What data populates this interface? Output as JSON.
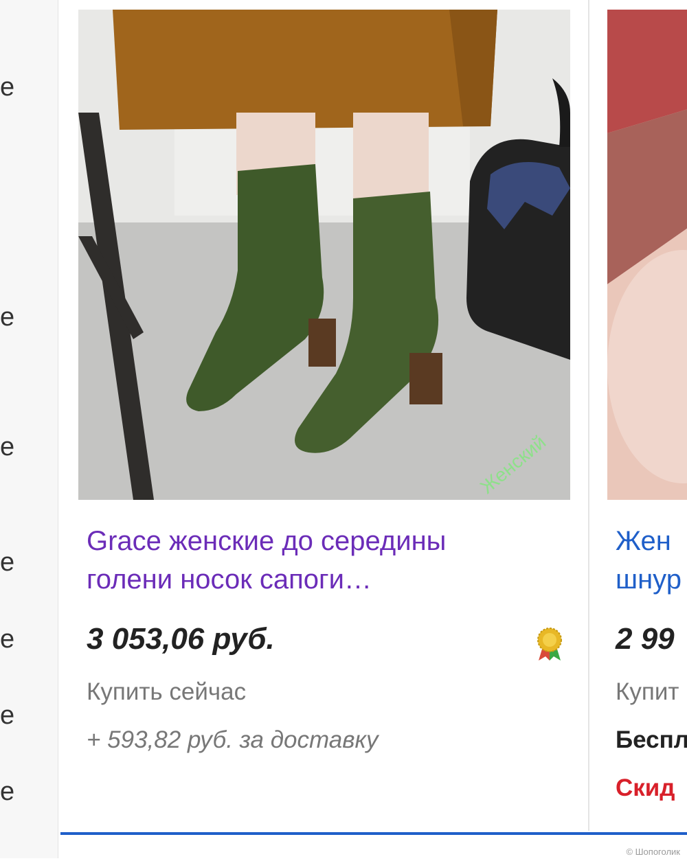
{
  "sidebar": {
    "fragments": [
      "e",
      "e",
      "e",
      "e",
      "e",
      "e",
      "e"
    ]
  },
  "product1": {
    "title_line1": "Grace женские до середины",
    "title_line2": "голени носок сапоги…",
    "price": "3 053,06 руб.",
    "buy_label": "Купить сейчас",
    "shipping": "+ 593,82 руб. за доставку",
    "image_watermark": "Женский"
  },
  "product2": {
    "title_line1": "Жен",
    "title_line2": "шнур",
    "price": "2 99",
    "buy_label": "Купит",
    "shipping": "Беспл.",
    "discount": "Скид"
  },
  "page_watermark": "© Шопоголик",
  "colors": {
    "title_visited": "#6b2cb8",
    "title_link": "#1f5fc9",
    "discount_red": "#d8202a",
    "bottom_border": "#1f5fc9"
  },
  "icons": {
    "seller_badge": "award-ribbon-icon"
  }
}
